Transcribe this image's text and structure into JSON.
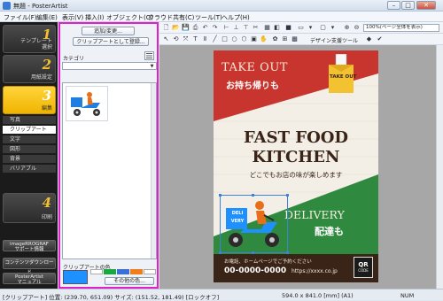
{
  "window": {
    "title": "無題 - PosterArtist",
    "minimize": "–",
    "maximize": "□",
    "close": "✕"
  },
  "menu": [
    "ファイル(F)",
    "編集(E)",
    "表示(V)",
    "挿入(I)",
    "オブジェクト(O)",
    "クラウド共有(C)",
    "ツール(T)",
    "ヘルプ(H)"
  ],
  "steps": [
    {
      "num": "1",
      "label": "テンプレート\n選択"
    },
    {
      "num": "2",
      "label": "用紙設定"
    },
    {
      "num": "3",
      "label": "編集"
    },
    {
      "num": "4",
      "label": "印刷"
    }
  ],
  "subitems": [
    "写真",
    "クリップアート",
    "文字",
    "図形",
    "背景",
    "バリアブル"
  ],
  "nav_buttons": [
    "imageRROGRAF\nサポート情報",
    "コンテンツダウンロード",
    "PosterArtist\nマニュアル"
  ],
  "panel": {
    "add_change": "追加/変更...",
    "register": "クリップアートとして登録...",
    "category_label": "カテゴリ",
    "color_label": "クリップアートの色",
    "other_colors": "その他の色..."
  },
  "swatch_colors": [
    "#1e90ff",
    "#ffffff",
    "#19a93f",
    "#3b6fd8",
    "#f07d1a",
    "#ffffff"
  ],
  "toolbar": {
    "design_support": "デザイン支援ツール",
    "zoom": "100%(ページ全体を表示)"
  },
  "poster": {
    "take_out_en": "TAKE OUT",
    "take_out_jp": "お持ち帰りも",
    "bag_text": "TAKE OUT",
    "title1": "FAST FOOD",
    "title2": "KITCHEN",
    "subtitle": "どこでもお店の味が楽しめます",
    "delivery_en": "DELIVERY",
    "delivery_jp": "配達も",
    "bike_box1": "DELI",
    "bike_box2": "VERY",
    "contact": "お電話、ホームページでご予約ください",
    "phone": "00-0000-0000",
    "url": "https://xxxx.co.jp",
    "qr1": "QR",
    "qr2": "CODE"
  },
  "status": {
    "left": "[クリップアート] 位置: (239.70, 651.09) サイズ: (151.52, 181.49) [ロックオフ]",
    "center": "594.0 x 841.0 [mm] (A1)",
    "right": "NUM"
  }
}
